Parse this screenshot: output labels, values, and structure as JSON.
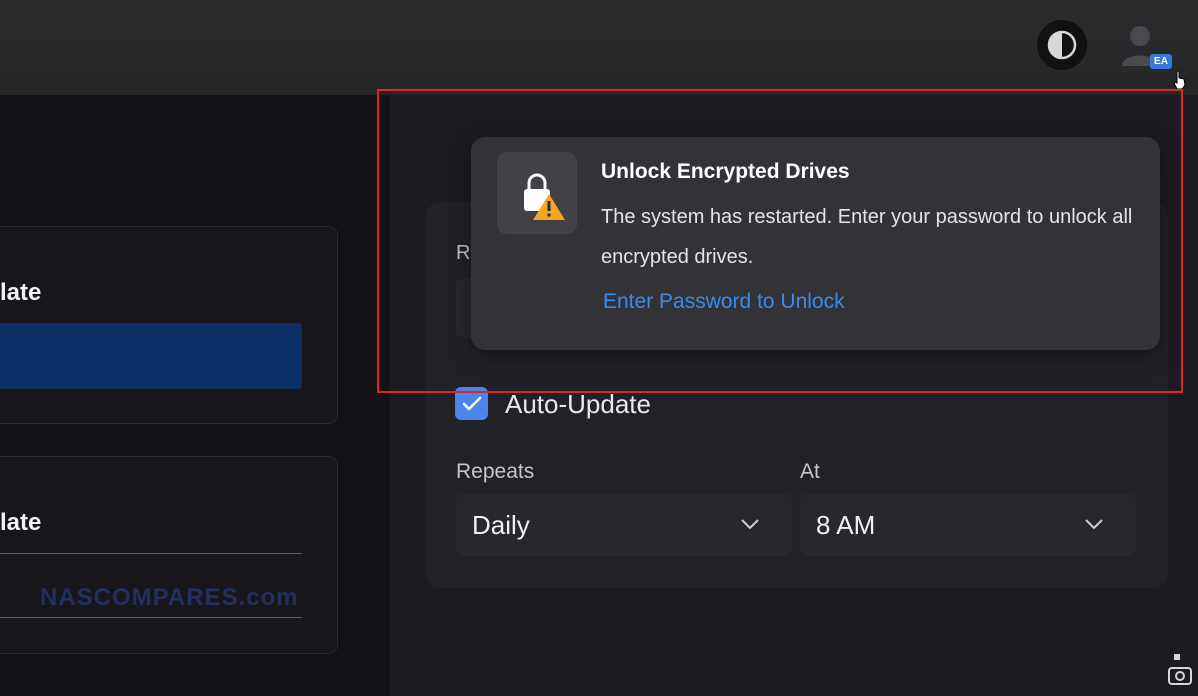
{
  "header": {
    "theme_toggle_icon": "contrast-icon",
    "avatar_icon": "user-avatar-icon",
    "avatar_initials": "EA"
  },
  "left_panel": {
    "cards": [
      {
        "title_fragment": "late"
      },
      {
        "title_fragment": "late"
      }
    ],
    "watermark": "NASCOMPARES.com"
  },
  "settings": {
    "partial_label": "Re",
    "auto_update_label": "Auto-Update",
    "auto_update_checked": true,
    "repeats_label": "Repeats",
    "repeats_value": "Daily",
    "at_label": "At",
    "at_value": "8 AM"
  },
  "notification": {
    "icon": "lock-warning-icon",
    "title": "Unlock Encrypted Drives",
    "message": "The system has restarted. Enter your password to unlock all encrypted drives.",
    "link_label": "Enter Password to Unlock",
    "highlight_color": "#e0242c"
  },
  "colors": {
    "accent": "#4a86e8",
    "link": "#3c8ae8",
    "selected_row": "#0c2f66"
  }
}
